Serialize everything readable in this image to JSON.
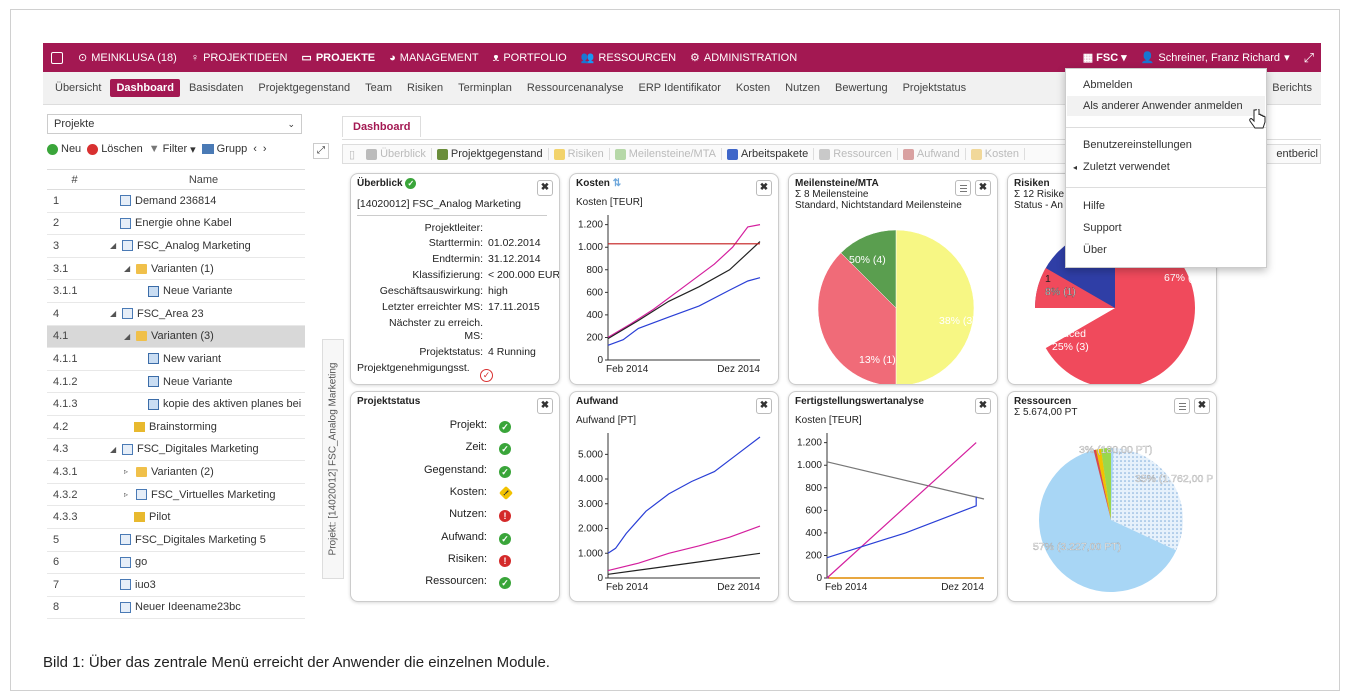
{
  "topnav": {
    "items": [
      {
        "label": "MEINKLUSA (18)",
        "icon": "clock-icon"
      },
      {
        "label": "PROJEKTIDEEN",
        "icon": "lightbulb-icon"
      },
      {
        "label": "PROJEKTE",
        "icon": "calendar-icon",
        "active": true
      },
      {
        "label": "MANAGEMENT",
        "icon": "chart-icon"
      },
      {
        "label": "PORTFOLIO",
        "icon": "binoculars-icon"
      },
      {
        "label": "RESSOURCEN",
        "icon": "users-icon"
      },
      {
        "label": "ADMINISTRATION",
        "icon": "gear-icon"
      }
    ],
    "org": "FSC",
    "user": "Schreiner, Franz Richard",
    "accent": "#a31852"
  },
  "subnav": {
    "items": [
      "Übersicht",
      "Dashboard",
      "Basisdaten",
      "Projektgegenstand",
      "Team",
      "Risiken",
      "Terminplan",
      "Ressourcenanalyse",
      "ERP Identifikator",
      "Kosten",
      "Nutzen",
      "Bewertung",
      "Projektstatus"
    ],
    "active": "Dashboard",
    "trailing": "Berichts"
  },
  "usermenu": {
    "items": [
      "Abmelden",
      "Als anderer Anwender anmelden",
      "Benutzereinstellungen",
      "Zuletzt verwendet",
      "Hilfe",
      "Support",
      "Über"
    ]
  },
  "left": {
    "select": "Projekte",
    "toolbar": {
      "new": "Neu",
      "delete": "Löschen",
      "filter": "Filter",
      "group": "Grupp"
    },
    "col_num": "#",
    "col_name": "Name",
    "rows": [
      {
        "num": "1",
        "name": "Demand 236814",
        "icon": "doc",
        "indent": 0,
        "arrow": ""
      },
      {
        "num": "2",
        "name": "Energie ohne Kabel",
        "icon": "doc",
        "indent": 0,
        "arrow": ""
      },
      {
        "num": "3",
        "name": "FSC_Analog Marketing",
        "icon": "doc",
        "indent": 0,
        "arrow": "◢"
      },
      {
        "num": "3.1",
        "name": "Varianten (1)",
        "icon": "fold",
        "indent": 1,
        "arrow": "◢"
      },
      {
        "num": "3.1.1",
        "name": "Neue Variante",
        "icon": "var",
        "indent": 2,
        "arrow": ""
      },
      {
        "num": "4",
        "name": "FSC_Area 23",
        "icon": "doc",
        "indent": 0,
        "arrow": "◢"
      },
      {
        "num": "4.1",
        "name": "Varianten (3)",
        "icon": "fold",
        "indent": 1,
        "arrow": "◢",
        "sel": true
      },
      {
        "num": "4.1.1",
        "name": "New variant",
        "icon": "var",
        "indent": 2,
        "arrow": ""
      },
      {
        "num": "4.1.2",
        "name": "Neue Variante",
        "icon": "var",
        "indent": 2,
        "arrow": ""
      },
      {
        "num": "4.1.3",
        "name": "kopie des aktiven planes bei",
        "icon": "var",
        "indent": 2,
        "arrow": ""
      },
      {
        "num": "4.2",
        "name": "Brainstorming",
        "icon": "pilot",
        "indent": 1,
        "arrow": ""
      },
      {
        "num": "4.3",
        "name": "FSC_Digitales Marketing",
        "icon": "doc",
        "indent": 0,
        "arrow": "◢"
      },
      {
        "num": "4.3.1",
        "name": "Varianten (2)",
        "icon": "fold",
        "indent": 1,
        "arrow": "▹"
      },
      {
        "num": "4.3.2",
        "name": "FSC_Virtuelles Marketing",
        "icon": "doc",
        "indent": 1,
        "arrow": "▹"
      },
      {
        "num": "4.3.3",
        "name": "Pilot",
        "icon": "pilot",
        "indent": 1,
        "arrow": ""
      },
      {
        "num": "5",
        "name": "FSC_Digitales Marketing 5",
        "icon": "doc",
        "indent": 0,
        "arrow": ""
      },
      {
        "num": "6",
        "name": "go",
        "icon": "doc",
        "indent": 0,
        "arrow": ""
      },
      {
        "num": "7",
        "name": "iuo3",
        "icon": "doc",
        "indent": 0,
        "arrow": ""
      },
      {
        "num": "8",
        "name": "Neuer Ideename23bc",
        "icon": "doc",
        "indent": 0,
        "arrow": ""
      }
    ],
    "vertical_tab": "Projekt: [14020012] FSC_Analog Marketing"
  },
  "main": {
    "tab": "Dashboard",
    "widgetbar": [
      {
        "label": "Überblick",
        "on": false,
        "color": "#bbb"
      },
      {
        "label": "Projektgegenstand",
        "on": true,
        "color": "#6a8d3a"
      },
      {
        "label": "Risiken",
        "on": false,
        "color": "#f2d36b"
      },
      {
        "label": "Meilensteine/MTA",
        "on": false,
        "color": "#b6d8a8"
      },
      {
        "label": "Arbeitspakete",
        "on": true,
        "color": "#3f66c9"
      },
      {
        "label": "Ressourcen",
        "on": false,
        "color": "#c9c9c9"
      },
      {
        "label": "Aufwand",
        "on": false,
        "color": "#d9a1a1"
      },
      {
        "label": "Kosten",
        "on": false,
        "color": "#f1d89a"
      }
    ],
    "widgetbar_trailing": "entbericl"
  },
  "ueberblick": {
    "title": "Überblick",
    "project": "[14020012] FSC_Analog Marketing",
    "fields": [
      {
        "k": "Projektleiter:",
        "v": ""
      },
      {
        "k": "Starttermin:",
        "v": "01.02.2014"
      },
      {
        "k": "Endtermin:",
        "v": "31.12.2014"
      },
      {
        "k": "Klassifizierung:",
        "v": "< 200.000 EUR"
      },
      {
        "k": "Geschäftsauswirkung:",
        "v": "high"
      },
      {
        "k": "Letzter erreichter MS:",
        "v": "17.11.2015"
      },
      {
        "k": "Nächster zu erreich.",
        "v": ""
      },
      {
        "k": "MS:",
        "v": ""
      },
      {
        "k": "Projektstatus:",
        "v": "4 Running"
      },
      {
        "k": "Projektgenehmigungsst.",
        "v": ""
      }
    ]
  },
  "projektstatus": {
    "title": "Projektstatus",
    "rows": [
      {
        "k": "Projekt:",
        "s": "ok"
      },
      {
        "k": "Zeit:",
        "s": "ok"
      },
      {
        "k": "Gegenstand:",
        "s": "ok"
      },
      {
        "k": "Kosten:",
        "s": "warn"
      },
      {
        "k": "Nutzen:",
        "s": "err"
      },
      {
        "k": "Aufwand:",
        "s": "ok"
      },
      {
        "k": "Risiken:",
        "s": "err"
      },
      {
        "k": "Ressourcen:",
        "s": "ok"
      }
    ]
  },
  "chart_data": [
    {
      "type": "line",
      "title": "Kosten",
      "ylabel": "Kosten [TEUR]",
      "x": [
        "Feb 2014",
        "Dez 2014"
      ],
      "yticks": [
        "0",
        "200",
        "400",
        "600",
        "800",
        "1.000",
        "1.200"
      ],
      "ylim": [
        0,
        1250
      ],
      "series": [
        {
          "color": "#d41f9e",
          "values": [
            [
              0,
              200
            ],
            [
              0.15,
              320
            ],
            [
              0.3,
              450
            ],
            [
              0.5,
              650
            ],
            [
              0.7,
              850
            ],
            [
              0.82,
              1000
            ],
            [
              0.92,
              1180
            ],
            [
              1,
              1200
            ]
          ]
        },
        {
          "color": "#222222",
          "values": [
            [
              0,
              190
            ],
            [
              0.2,
              350
            ],
            [
              0.4,
              520
            ],
            [
              0.6,
              650
            ],
            [
              0.8,
              800
            ],
            [
              1,
              1050
            ]
          ]
        },
        {
          "color": "#2a3fd6",
          "values": [
            [
              0,
              130
            ],
            [
              0.1,
              180
            ],
            [
              0.2,
              280
            ],
            [
              0.4,
              380
            ],
            [
              0.6,
              480
            ],
            [
              0.8,
              620
            ],
            [
              0.92,
              700
            ],
            [
              1,
              730
            ]
          ]
        },
        {
          "color": "#c41c1c",
          "values": [
            [
              0,
              1030
            ],
            [
              1,
              1030
            ]
          ]
        }
      ]
    },
    {
      "type": "pie",
      "title": "Meilensteine/MTA",
      "subtitle": "Σ 8 Meilensteine",
      "legend": "Standard, Nichtstandard Meilensteine",
      "slices": [
        {
          "label": "50% (4)",
          "value": 50,
          "color": "#f7f784"
        },
        {
          "label": "38% (3)",
          "value": 37.5,
          "color": "#f06b78"
        },
        {
          "label": "13% (1)",
          "value": 12.5,
          "color": "#5a9e4f"
        }
      ]
    },
    {
      "type": "pie",
      "title": "Risiken",
      "subtitle": "Σ 12 Risike",
      "legend": "Status - An",
      "slices": [
        {
          "label": "67% (8)",
          "value": 66.7,
          "color": "#f04a5c"
        },
        {
          "label": "reduced 25% (3)",
          "value": 25,
          "color": "#2f3ea6"
        },
        {
          "label": "1 8% (1)",
          "value": 8.3,
          "color": "#ffffff"
        }
      ]
    },
    {
      "type": "line",
      "title": "Aufwand",
      "ylabel": "Aufwand [PT]",
      "x": [
        "Feb 2014",
        "Dez 2014"
      ],
      "yticks": [
        "0",
        "1.000",
        "2.000",
        "3.000",
        "4.000",
        "5.000"
      ],
      "ylim": [
        0,
        5700
      ],
      "series": [
        {
          "color": "#2a3fd6",
          "values": [
            [
              0,
              1000
            ],
            [
              0.05,
              1200
            ],
            [
              0.12,
              1800
            ],
            [
              0.25,
              2700
            ],
            [
              0.4,
              3400
            ],
            [
              0.55,
              3900
            ],
            [
              0.7,
              4300
            ],
            [
              0.85,
              5000
            ],
            [
              1,
              5700
            ]
          ]
        },
        {
          "color": "#d41f9e",
          "values": [
            [
              0,
              300
            ],
            [
              0.2,
              600
            ],
            [
              0.4,
              1000
            ],
            [
              0.6,
              1300
            ],
            [
              0.8,
              1650
            ],
            [
              1,
              2100
            ]
          ]
        },
        {
          "color": "#222222",
          "values": [
            [
              0,
              150
            ],
            [
              0.3,
              400
            ],
            [
              0.6,
              650
            ],
            [
              1,
              1000
            ]
          ]
        }
      ]
    },
    {
      "type": "line",
      "title": "Fertigstellungswertanalyse",
      "ylabel": "Kosten [TEUR]",
      "x": [
        "Feb 2014",
        "Dez 2014"
      ],
      "yticks": [
        "0",
        "200",
        "400",
        "600",
        "800",
        "1.000",
        "1.200"
      ],
      "ylim": [
        0,
        1250
      ],
      "series": [
        {
          "color": "#777777",
          "values": [
            [
              0,
              1030
            ],
            [
              1,
              700
            ]
          ]
        },
        {
          "color": "#d41f9e",
          "values": [
            [
              0,
              0
            ],
            [
              0.95,
              1200
            ]
          ]
        },
        {
          "color": "#2a3fd6",
          "values": [
            [
              0,
              180
            ],
            [
              0.5,
              400
            ],
            [
              0.95,
              640
            ],
            [
              0.95,
              720
            ]
          ]
        }
      ]
    },
    {
      "type": "pie",
      "title": "Ressourcen",
      "subtitle": "Σ 5.674,00 PT",
      "slices": [
        {
          "label": "57% (3.227,00 PT)",
          "value": 56.9,
          "color": "#a8d6f5"
        },
        {
          "label": "3% (180,00 PT)",
          "value": 3.2,
          "color": "#9bd84a"
        },
        {
          "label": "35% (1.762,00 P",
          "value": 31.1,
          "color": "#dceaf7"
        }
      ]
    }
  ],
  "caption": "Bild 1: Über das zentrale Menü erreicht der Anwender die einzelnen Module."
}
